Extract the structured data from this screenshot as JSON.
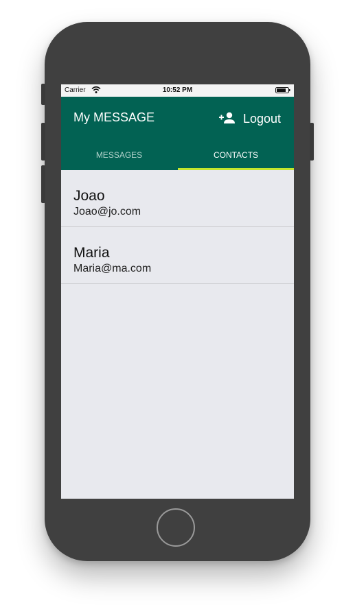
{
  "statusbar": {
    "carrier": "Carrier",
    "time": "10:52 PM",
    "icons": [
      "wifi-icon",
      "battery-icon"
    ]
  },
  "appbar": {
    "title": "My MESSAGE",
    "add_contact_icon": "add-person-icon",
    "logout_label": "Logout",
    "color": "#026253"
  },
  "tabs": [
    {
      "label": "MESSAGES",
      "selected": false
    },
    {
      "label": "CONTACTS",
      "selected": true
    }
  ],
  "tab_indicator_color": "#c4e62d",
  "contacts": [
    {
      "name": "Joao",
      "email": "Joao@jo.com"
    },
    {
      "name": "Maria",
      "email": "Maria@ma.com"
    }
  ]
}
